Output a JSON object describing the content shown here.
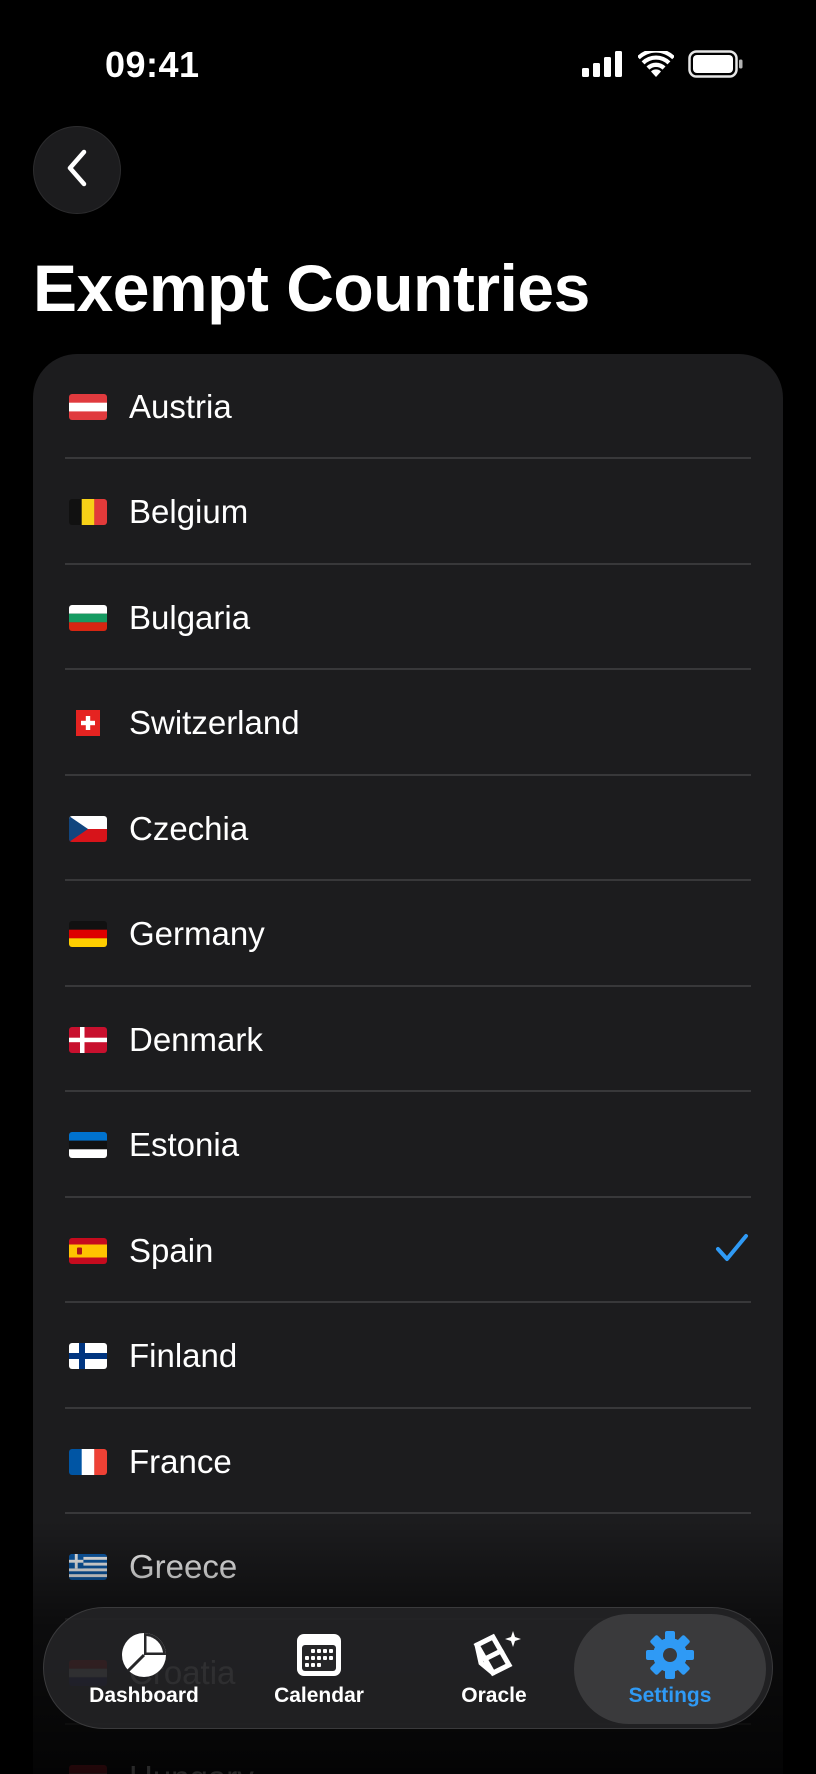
{
  "status_bar": {
    "time": "09:41"
  },
  "page": {
    "title": "Exempt Countries"
  },
  "countries": [
    {
      "name": "Austria",
      "flag": "austria-flag",
      "selected": false
    },
    {
      "name": "Belgium",
      "flag": "belgium-flag",
      "selected": false
    },
    {
      "name": "Bulgaria",
      "flag": "bulgaria-flag",
      "selected": false
    },
    {
      "name": "Switzerland",
      "flag": "switzerland-flag",
      "selected": false
    },
    {
      "name": "Czechia",
      "flag": "czechia-flag",
      "selected": false
    },
    {
      "name": "Germany",
      "flag": "germany-flag",
      "selected": false
    },
    {
      "name": "Denmark",
      "flag": "denmark-flag",
      "selected": false
    },
    {
      "name": "Estonia",
      "flag": "estonia-flag",
      "selected": false
    },
    {
      "name": "Spain",
      "flag": "spain-flag",
      "selected": true
    },
    {
      "name": "Finland",
      "flag": "finland-flag",
      "selected": false
    },
    {
      "name": "France",
      "flag": "france-flag",
      "selected": false
    },
    {
      "name": "Greece",
      "flag": "greece-flag",
      "selected": false
    },
    {
      "name": "Croatia",
      "flag": "croatia-flag",
      "selected": false
    },
    {
      "name": "Hungary",
      "flag": "hungary-flag",
      "selected": false
    }
  ],
  "tab_bar": {
    "tabs": [
      {
        "label": "Dashboard",
        "icon": "pie-chart-icon",
        "active": false
      },
      {
        "label": "Calendar",
        "icon": "calendar-icon",
        "active": false
      },
      {
        "label": "Oracle",
        "icon": "oracle-sparkle-icon",
        "active": false
      },
      {
        "label": "Settings",
        "icon": "gear-icon",
        "active": true
      }
    ]
  },
  "colors": {
    "accent": "#2f9af5",
    "card": "#1c1c1e",
    "divider": "#38383a"
  }
}
